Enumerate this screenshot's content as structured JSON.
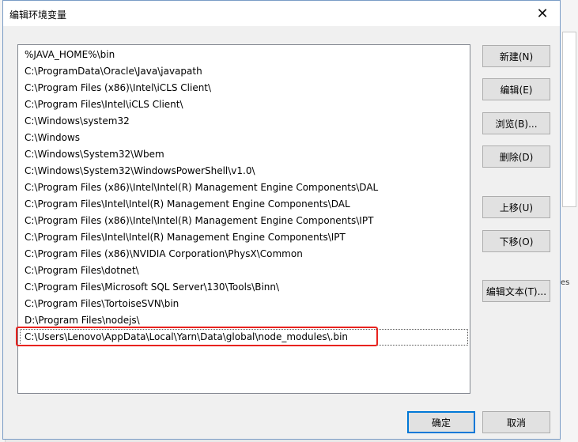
{
  "dialog": {
    "title": "编辑环境变量",
    "close_label": "✕"
  },
  "paths": [
    "%JAVA_HOME%\\bin",
    "C:\\ProgramData\\Oracle\\Java\\javapath",
    "C:\\Program Files (x86)\\Intel\\iCLS Client\\",
    "C:\\Program Files\\Intel\\iCLS Client\\",
    "C:\\Windows\\system32",
    "C:\\Windows",
    "C:\\Windows\\System32\\Wbem",
    "C:\\Windows\\System32\\WindowsPowerShell\\v1.0\\",
    "C:\\Program Files (x86)\\Intel\\Intel(R) Management Engine Components\\DAL",
    "C:\\Program Files\\Intel\\Intel(R) Management Engine Components\\DAL",
    "C:\\Program Files (x86)\\Intel\\Intel(R) Management Engine Components\\IPT",
    "C:\\Program Files\\Intel\\Intel(R) Management Engine Components\\IPT",
    "C:\\Program Files (x86)\\NVIDIA Corporation\\PhysX\\Common",
    "C:\\Program Files\\dotnet\\",
    "C:\\Program Files\\Microsoft SQL Server\\130\\Tools\\Binn\\",
    "C:\\Program Files\\TortoiseSVN\\bin",
    "D:\\Program Files\\nodejs\\",
    "C:\\Users\\Lenovo\\AppData\\Local\\Yarn\\Data\\global\\node_modules\\.bin"
  ],
  "selected_index": 17,
  "buttons": {
    "new": "新建(N)",
    "edit": "编辑(E)",
    "browse": "浏览(B)...",
    "delete": "删除(D)",
    "move_up": "上移(U)",
    "move_down": "下移(O)",
    "edit_text": "编辑文本(T)...",
    "ok": "确定",
    "cancel": "取消"
  },
  "background_fragment": "es",
  "colors": {
    "highlight": "#e8231f",
    "default_button_border": "#0078d7"
  }
}
